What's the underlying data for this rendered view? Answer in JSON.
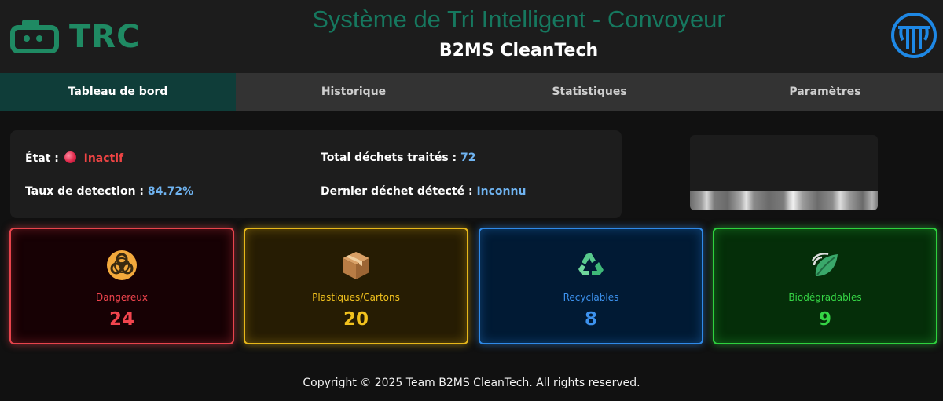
{
  "header": {
    "logo_text": "TRC",
    "title": "Système de Tri Intelligent - Convoyeur",
    "subtitle": "B2MS CleanTech"
  },
  "nav": {
    "tabs": [
      {
        "label": "Tableau de bord",
        "active": true
      },
      {
        "label": "Historique",
        "active": false
      },
      {
        "label": "Statistiques",
        "active": false
      },
      {
        "label": "Paramètres",
        "active": false
      }
    ]
  },
  "status": {
    "etat_label": "État :",
    "etat_value": "Inactif",
    "total_label": "Total déchets traités :",
    "total_value": "72",
    "taux_label": "Taux de detection :",
    "taux_value": "84.72%",
    "dernier_label": "Dernier déchet détecté :",
    "dernier_value": "Inconnu"
  },
  "categories": [
    {
      "icon": "biohazard-icon",
      "label": "Dangereux",
      "count": "24",
      "color": "#f2454e"
    },
    {
      "icon": "package-icon",
      "label": "Plastiques/Cartons",
      "count": "20",
      "color": "#f2c21e"
    },
    {
      "icon": "recycle-icon",
      "label": "Recyclables",
      "count": "8",
      "color": "#3d92ee"
    },
    {
      "icon": "leaf-icon",
      "label": "Biodégradables",
      "count": "9",
      "color": "#35d445"
    }
  ],
  "footer": {
    "text": "Copyright © 2025 Team B2MS CleanTech. All rights reserved."
  },
  "colors": {
    "accent": "#16785f",
    "logo": "#1f8a63",
    "active_tab": "#0f3d39",
    "value_blue": "#6fb3f0",
    "inactive_red": "#ee4444"
  }
}
